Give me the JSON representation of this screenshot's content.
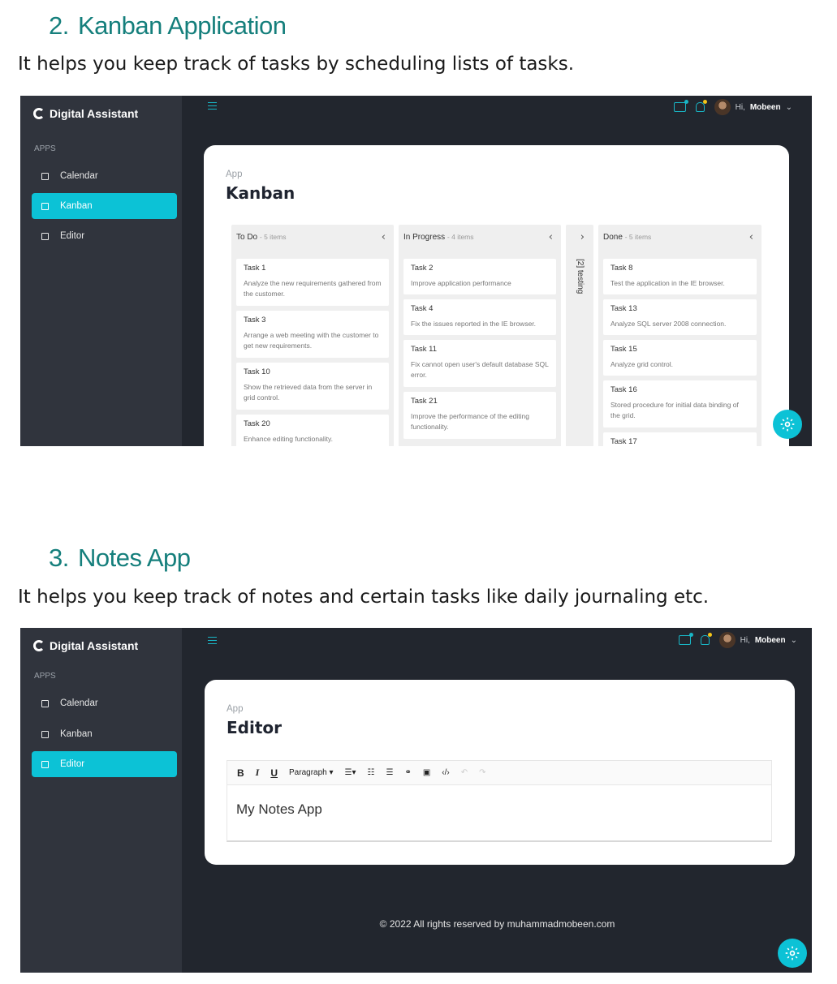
{
  "section1": {
    "number": "2.",
    "title": "Kanban Application",
    "description": "It helps you keep track of tasks by scheduling lists of tasks."
  },
  "section2": {
    "number": "3.",
    "title": "Notes App",
    "description": "It helps you keep track of notes and certain tasks like daily journaling etc."
  },
  "app": {
    "brand": "Digital Assistant",
    "apps_label": "APPS",
    "nav": [
      "Calendar",
      "Kanban",
      "Editor"
    ],
    "user_greeting": "Hi,",
    "user_name": "Mobeen",
    "accent_color": "#0cc2d6",
    "notification_dot_chat": "#19b6c6",
    "notification_dot_bell": "#f5c518"
  },
  "kanban": {
    "breadcrumb": "App",
    "title": "Kanban",
    "columns": [
      {
        "name": "To Do",
        "count": "- 5 items",
        "tasks": [
          {
            "title": "Task 1",
            "desc": "Analyze the new requirements gathered from the customer."
          },
          {
            "title": "Task 3",
            "desc": "Arrange a web meeting with the customer to get new requirements."
          },
          {
            "title": "Task 10",
            "desc": "Show the retrieved data from the server in grid control."
          },
          {
            "title": "Task 20",
            "desc": "Enhance editing functionality."
          }
        ]
      },
      {
        "name": "In Progress",
        "count": "- 4 items",
        "tasks": [
          {
            "title": "Task 2",
            "desc": "Improve application performance"
          },
          {
            "title": "Task 4",
            "desc": "Fix the issues reported in the IE browser."
          },
          {
            "title": "Task 11",
            "desc": "Fix cannot open user's default database SQL error."
          },
          {
            "title": "Task 21",
            "desc": "Improve the performance of the editing functionality."
          }
        ]
      },
      {
        "name": "Done",
        "count": "- 5 items",
        "tasks": [
          {
            "title": "Task 8",
            "desc": "Test the application in the IE browser."
          },
          {
            "title": "Task 13",
            "desc": "Analyze SQL server 2008 connection."
          },
          {
            "title": "Task 15",
            "desc": "Analyze grid control."
          },
          {
            "title": "Task 16",
            "desc": "Stored procedure for initial data binding of the grid."
          },
          {
            "title": "Task 17",
            "desc": ""
          }
        ]
      }
    ],
    "collapsed_column": "[2] testing"
  },
  "editor": {
    "breadcrumb": "App",
    "title": "Editor",
    "toolbar": {
      "bold": "B",
      "italic": "I",
      "underline": "U",
      "format": "Paragraph"
    },
    "content": "My Notes App",
    "footer": "© 2022 All rights reserved by muhammadmobeen.com"
  }
}
